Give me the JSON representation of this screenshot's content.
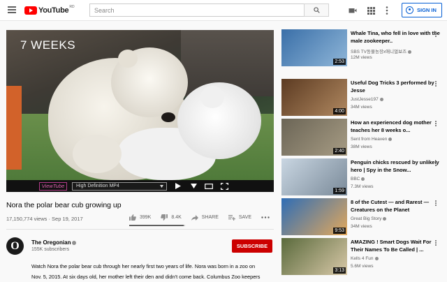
{
  "header": {
    "logo_text": "YouTube",
    "logo_sup": "RD",
    "search_placeholder": "Search",
    "signin_label": "SIGN IN"
  },
  "player": {
    "overlay_text": "7 WEEKS",
    "viewtube_label": "ViewTube",
    "quality_label": "High Definition MP4"
  },
  "video": {
    "title": "Nora the polar bear cub growing up",
    "views_date": "17,150,774 views · Sep 19, 2017",
    "likes": "399K",
    "dislikes": "8.4K",
    "share_label": "SHARE",
    "save_label": "SAVE",
    "like_ratio": 0.98
  },
  "channel": {
    "avatar_letter": "O",
    "name": "The Oregonian",
    "subscribers": "155K subscribers",
    "subscribe_label": "SUBSCRIBE"
  },
  "description": {
    "line1": "Watch Nora the polar bear cub through her nearly first two years of life. Nora was born in a zoo on",
    "line2": "Nov. 5, 2015. At six days old, her mother left their den and didn't come back. Columbus Zoo keepers"
  },
  "recommendations": [
    {
      "title": "Whale Tina, who fell in love with the male zookeeper..",
      "channel": "SBS TV동물농장x애니멀보즈",
      "views": "12M views",
      "duration": "2:53",
      "colors": [
        "#3a6fa8",
        "#8fb6d8"
      ]
    },
    {
      "title": "Useful Dog Tricks 3 performed by Jesse",
      "channel": "JustJesse197",
      "views": "34M views",
      "duration": "4:00",
      "colors": [
        "#5c3b22",
        "#b08860"
      ]
    },
    {
      "title": "How an experienced dog mother teaches her 8 weeks o...",
      "channel": "Sent from Heaven",
      "views": "38M views",
      "duration": "2:40",
      "colors": [
        "#6b6556",
        "#a79c84"
      ]
    },
    {
      "title": "Penguin chicks rescued by unlikely hero | Spy in the Snow...",
      "channel": "BBC",
      "views": "7.3M views",
      "duration": "1:59",
      "colors": [
        "#c9d6e2",
        "#7a8a99"
      ]
    },
    {
      "title": "8 of the Cutest — and Rarest — Creatures on the Planet",
      "channel": "Great Big Story",
      "views": "34M views",
      "duration": "9:53",
      "colors": [
        "#2f6db5",
        "#e2a85c"
      ]
    },
    {
      "title": "AMAZING ! Smart Dogs Wait For Their Names To Be Called | ...",
      "channel": "Kells 4 Fun",
      "views": "5.6M views",
      "duration": "3:13",
      "colors": [
        "#5a6a3c",
        "#d8c8a8"
      ]
    }
  ]
}
